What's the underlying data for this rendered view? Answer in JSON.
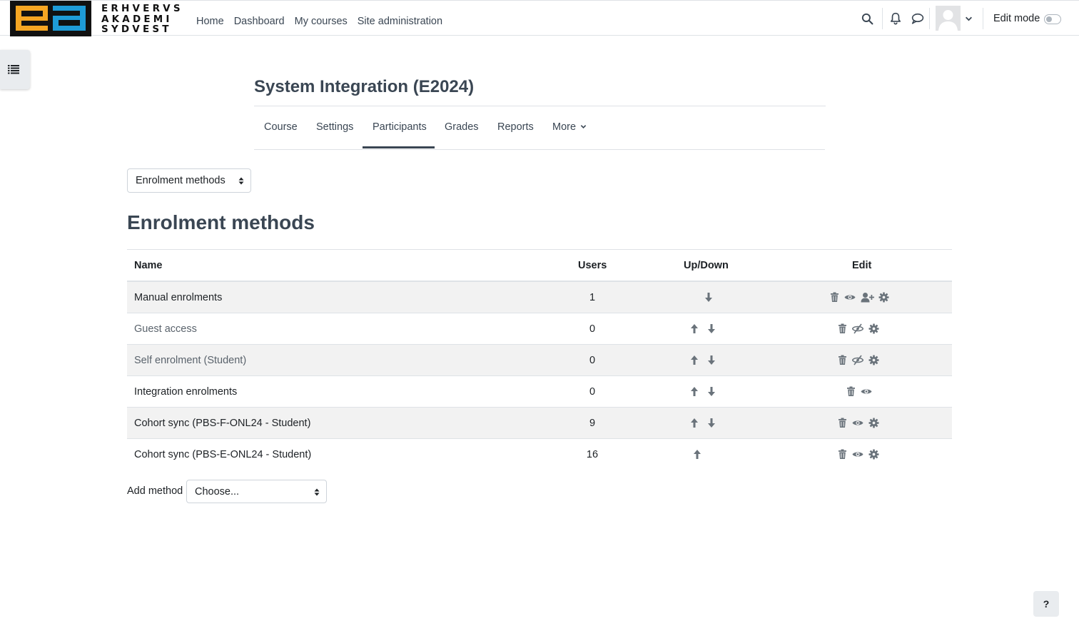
{
  "navbar": {
    "logo_lines": [
      "ERHVERVS",
      "AKADEMI",
      "SYDVEST"
    ],
    "links": [
      "Home",
      "Dashboard",
      "My courses",
      "Site administration"
    ],
    "icons": [
      "search-icon",
      "bell-icon",
      "chat-icon",
      "avatar",
      "chevron-down-icon"
    ],
    "edit_mode_label": "Edit mode",
    "edit_mode_on": false
  },
  "drawer_toggle_icon": "list-icon",
  "course": {
    "title": "System Integration (E2024)",
    "tabs": [
      "Course",
      "Settings",
      "Participants",
      "Grades",
      "Reports",
      "More"
    ],
    "active_tab": "Participants"
  },
  "page_selector": {
    "value": "Enrolment methods"
  },
  "heading": "Enrolment methods",
  "table": {
    "headers": {
      "name": "Name",
      "users": "Users",
      "updown": "Up/Down",
      "edit": "Edit"
    },
    "rows": [
      {
        "name": "Manual enrolments",
        "users": "1",
        "up": false,
        "down": true,
        "edit": [
          "trash-icon",
          "eye-icon",
          "user-plus-icon",
          "gear-icon"
        ],
        "dimmed": false
      },
      {
        "name": "Guest access",
        "users": "0",
        "up": true,
        "down": true,
        "edit": [
          "trash-icon",
          "eye-slash-icon",
          "gear-icon"
        ],
        "dimmed": true
      },
      {
        "name": "Self enrolment (Student)",
        "users": "0",
        "up": true,
        "down": true,
        "edit": [
          "trash-icon",
          "eye-slash-icon",
          "gear-icon"
        ],
        "dimmed": true
      },
      {
        "name": "Integration enrolments",
        "users": "0",
        "up": true,
        "down": true,
        "edit": [
          "trash-icon",
          "eye-icon"
        ],
        "dimmed": false
      },
      {
        "name": "Cohort sync (PBS-F-ONL24 - Student)",
        "users": "9",
        "up": true,
        "down": true,
        "edit": [
          "trash-icon",
          "eye-icon",
          "gear-icon"
        ],
        "dimmed": false
      },
      {
        "name": "Cohort sync (PBS-E-ONL24 - Student)",
        "users": "16",
        "up": true,
        "down": false,
        "edit": [
          "trash-icon",
          "eye-icon",
          "gear-icon"
        ],
        "dimmed": false
      }
    ]
  },
  "add_method": {
    "label": "Add method",
    "value": "Choose..."
  },
  "help_button": "?",
  "colors": {
    "logo_orange": "#f6a623",
    "logo_blue": "#1e9bd7",
    "icon_gray": "#6a737b",
    "text": "#1d2125"
  }
}
